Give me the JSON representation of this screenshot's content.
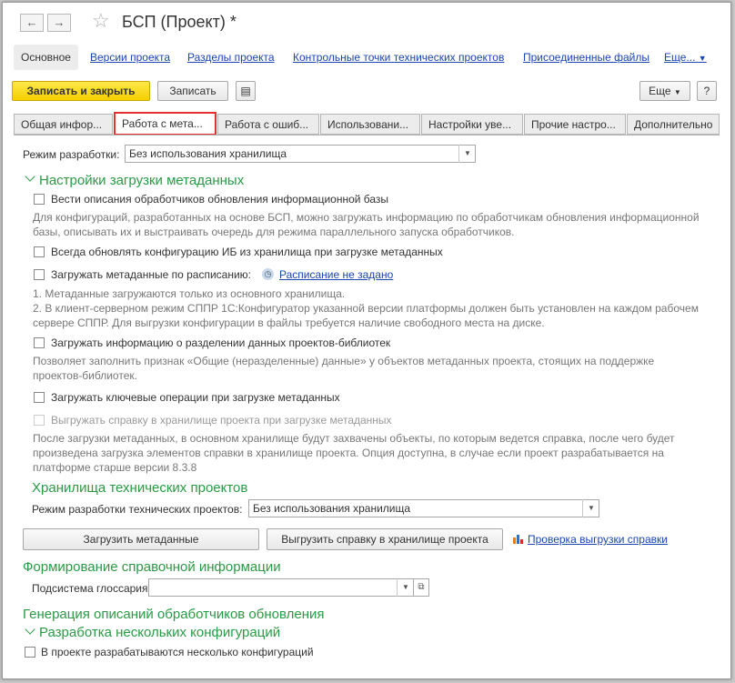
{
  "window": {
    "title": "БСП (Проект) *"
  },
  "nav": {
    "tabs": [
      {
        "label": "Основное"
      },
      {
        "label": "Версии проекта"
      },
      {
        "label": "Разделы проекта"
      },
      {
        "label": "Контрольные точки технических проектов"
      },
      {
        "label": "Присоединенные файлы"
      },
      {
        "label": "Еще..."
      }
    ]
  },
  "toolbar": {
    "save_close_label": "Записать и закрыть",
    "save_label": "Записать",
    "more_label": "Еще",
    "help_label": "?"
  },
  "tabs": [
    {
      "label": "Общая инфор..."
    },
    {
      "label": "Работа с мета..."
    },
    {
      "label": "Работа с ошиб..."
    },
    {
      "label": "Использовани..."
    },
    {
      "label": "Настройки уве..."
    },
    {
      "label": "Прочие настро..."
    },
    {
      "label": "Дополнительно"
    }
  ],
  "form": {
    "dev_mode_label": "Режим разработки:",
    "dev_mode_value": "Без использования хранилища",
    "load_section_title": "Настройки загрузки метаданных",
    "opt1_label": "Вести описания обработчиков обновления информационной базы",
    "opt1_note_1": "Для конфигураций, разработанных на основе БСП, можно загружать информацию по обработчикам обновления информационной",
    "opt1_note_2": "базы, описывать их и выстраивать очередь для режима параллельного запуска обработчиков.",
    "opt2_label": "Всегда обновлять конфигурацию ИБ из хранилища при загрузке метаданных",
    "opt3_label": "Загружать метаданные по расписанию:",
    "schedule_link": "Расписание не задано",
    "opt3_note_1": "1. Метаданные загружаются только из основного хранилища.",
    "opt3_note_2": "2. В клиент-серверном режим СППР 1С:Конфигуратор указанной версии платформы должен быть установлен на каждом рабочем",
    "opt3_note_3": "сервере СППР. Для выгрузки конфигурации в файлы требуется наличие свободного места на диске.",
    "opt4_label": "Загружать информацию о разделении данных проектов-библиотек",
    "opt4_note_1": "Позволяет заполнить признак «Общие (неразделенные) данные» у объектов метаданных проекта, стоящих на поддержке",
    "opt4_note_2": "проектов-библиотек.",
    "opt5_label": "Загружать ключевые операции при загрузке метаданных",
    "opt6_label": "Выгружать справку в хранилище проекта при загрузке метаданных",
    "opt6_note_1": "После загрузки метаданных, в основном хранилище будут захвачены объекты, по которым ведется справка, после чего будет",
    "opt6_note_2": "произведена загрузка элементов справки в хранилище проекта. Опция доступна, в случае если проект разрабатывается на",
    "opt6_note_3": "платформе старше версии 8.3.8",
    "tech_section_title": "Хранилища технических проектов",
    "tech_mode_label": "Режим разработки технических проектов:",
    "tech_mode_value": "Без использования хранилища",
    "load_meta_button": "Загрузить метаданные",
    "export_help_button": "Выгрузить справку в хранилище проекта",
    "check_export_link": "Проверка выгрузки справки",
    "ref_section_title": "Формирование справочной информации",
    "glossary_label": "Подсистема глоссария:",
    "glossary_value": "",
    "gen_section_title": "Генерация описаний обработчиков обновления",
    "multi_section_title": "Разработка нескольких конфигураций",
    "multi_label": "В проекте разрабатываются несколько конфигураций"
  },
  "colors": {
    "accent_green": "#2a9a45",
    "link_blue": "#1b44b4",
    "primary_yellow": "#f5cf00",
    "active_tab_border": "#e53030"
  }
}
